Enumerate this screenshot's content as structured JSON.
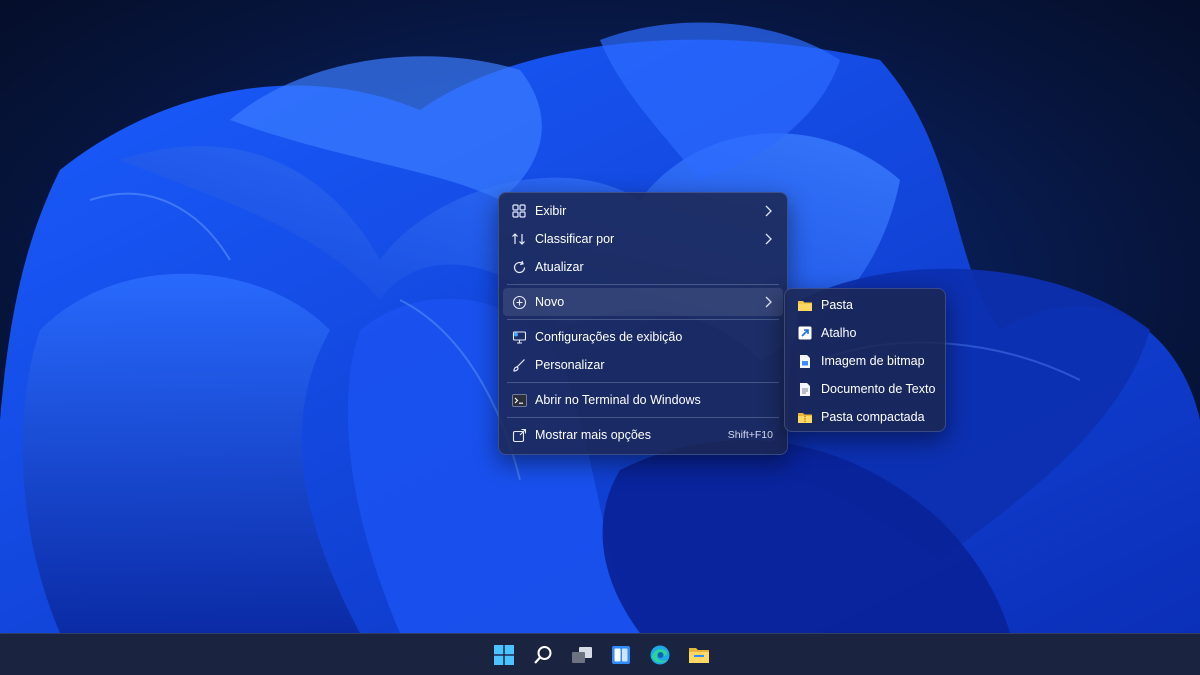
{
  "context_menu": {
    "items": [
      {
        "label": "Exibir",
        "icon": "grid-view-icon",
        "has_submenu": true
      },
      {
        "label": "Classificar por",
        "icon": "sort-icon",
        "has_submenu": true
      },
      {
        "label": "Atualizar",
        "icon": "refresh-icon",
        "has_submenu": false
      },
      {
        "label": "Novo",
        "icon": "plus-circle-icon",
        "has_submenu": true,
        "active": true
      },
      {
        "label": "Configurações de exibição",
        "icon": "display-settings-icon",
        "has_submenu": false
      },
      {
        "label": "Personalizar",
        "icon": "brush-icon",
        "has_submenu": false
      },
      {
        "label": "Abrir no Terminal do Windows",
        "icon": "terminal-icon",
        "has_submenu": false
      },
      {
        "label": "Mostrar mais opções",
        "icon": "more-options-icon",
        "shortcut": "Shift+F10"
      }
    ]
  },
  "submenu_new": {
    "items": [
      {
        "label": "Pasta",
        "icon": "folder-icon"
      },
      {
        "label": "Atalho",
        "icon": "shortcut-arrow-icon"
      },
      {
        "label": "Imagem de bitmap",
        "icon": "bitmap-file-icon"
      },
      {
        "label": "Documento de Texto",
        "icon": "text-document-icon"
      },
      {
        "label": "Pasta compactada",
        "icon": "zip-folder-icon"
      }
    ]
  },
  "taskbar": {
    "icons": [
      "start-icon",
      "search-icon",
      "task-view-icon",
      "widgets-icon",
      "edge-icon",
      "file-explorer-icon"
    ]
  },
  "colors": {
    "accent": "#2f6bff",
    "menu_background": "#1c2652",
    "taskbar_background": "#1a2340",
    "folder_yellow": "#f2c84b"
  }
}
